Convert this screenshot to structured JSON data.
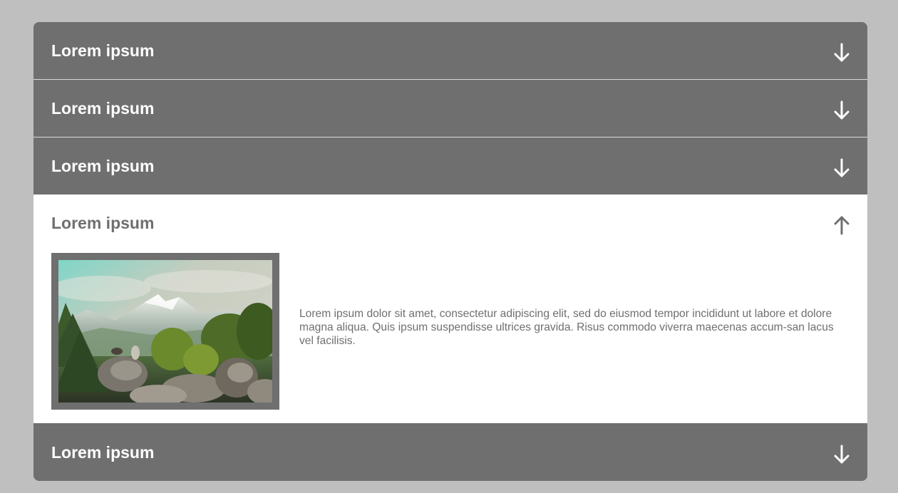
{
  "colors": {
    "background": "#bfbfbf",
    "panel": "#6f6f6f",
    "open_panel": "#ffffff",
    "text_light": "#ffffff",
    "text_dark": "#6f6f6f"
  },
  "accordion": {
    "items": [
      {
        "title": "Lorem ipsum",
        "icon": "arrow-down-icon",
        "expanded": false
      },
      {
        "title": "Lorem ipsum",
        "icon": "arrow-down-icon",
        "expanded": false
      },
      {
        "title": "Lorem ipsum",
        "icon": "arrow-down-icon",
        "expanded": false
      },
      {
        "title": "Lorem ipsum",
        "icon": "arrow-up-icon",
        "expanded": true,
        "image": "mountain-landscape-photo",
        "body": "Lorem ipsum dolor sit amet, consectetur adipiscing elit, sed do eiusmod tempor incididunt ut labore et dolore magna aliqua. Quis ipsum suspendisse ultrices gravida. Risus commodo viverra maecenas accum-san lacus vel facilisis."
      },
      {
        "title": "Lorem ipsum",
        "icon": "arrow-down-icon",
        "expanded": false
      }
    ]
  }
}
